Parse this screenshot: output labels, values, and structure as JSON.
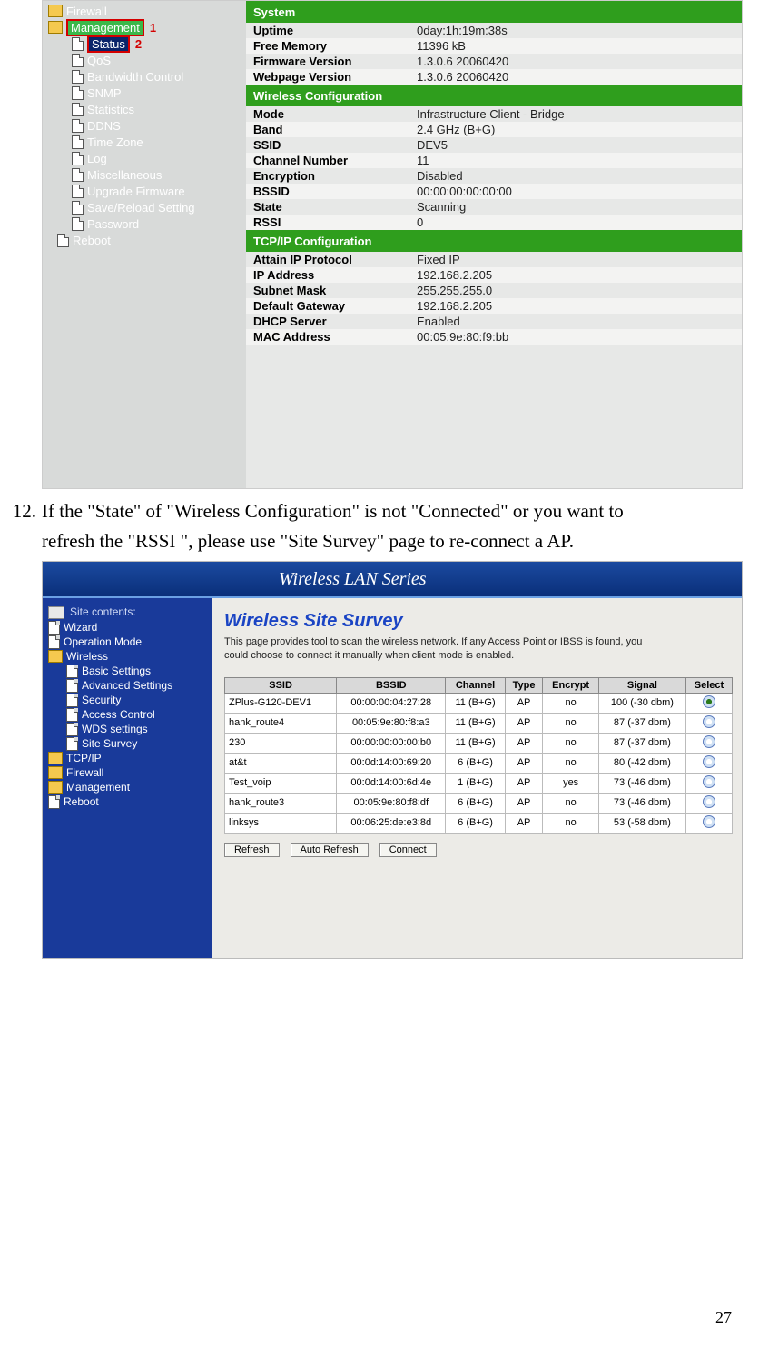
{
  "page_number": "27",
  "instruction": {
    "num": "12.",
    "text_l1": "If the \"State\" of \"Wireless Configuration\" is not \"Connected\" or you want to",
    "text_l2": "refresh the \"RSSI \", please use \"Site Survey\" page to re-connect a AP."
  },
  "shot1": {
    "tree": {
      "firewall": "Firewall",
      "management": "Management",
      "mgmt_badge": "1",
      "status": "Status",
      "status_badge": "2",
      "items": [
        "QoS",
        "Bandwidth Control",
        "SNMP",
        "Statistics",
        "DDNS",
        "Time Zone",
        "Log",
        "Miscellaneous",
        "Upgrade Firmware",
        "Save/Reload Setting",
        "Password"
      ],
      "reboot": "Reboot"
    },
    "sections": [
      {
        "header": "System",
        "rows": [
          {
            "k": "Uptime",
            "v": "0day:1h:19m:38s"
          },
          {
            "k": "Free Memory",
            "v": "11396 kB"
          },
          {
            "k": "Firmware Version",
            "v": "1.3.0.6 20060420"
          },
          {
            "k": "Webpage Version",
            "v": "1.3.0.6 20060420"
          }
        ]
      },
      {
        "header": "Wireless Configuration",
        "rows": [
          {
            "k": "Mode",
            "v": "Infrastructure Client - Bridge"
          },
          {
            "k": "Band",
            "v": "2.4 GHz (B+G)"
          },
          {
            "k": "SSID",
            "v": "DEV5"
          },
          {
            "k": "Channel Number",
            "v": "11"
          },
          {
            "k": "Encryption",
            "v": "Disabled"
          },
          {
            "k": "BSSID",
            "v": "00:00:00:00:00:00"
          },
          {
            "k": "State",
            "v": "Scanning"
          },
          {
            "k": "RSSI",
            "v": "0"
          }
        ]
      },
      {
        "header": "TCP/IP Configuration",
        "rows": [
          {
            "k": "Attain IP Protocol",
            "v": "Fixed IP"
          },
          {
            "k": "IP Address",
            "v": "192.168.2.205"
          },
          {
            "k": "Subnet Mask",
            "v": "255.255.255.0"
          },
          {
            "k": "Default Gateway",
            "v": "192.168.2.205"
          },
          {
            "k": "DHCP Server",
            "v": "Enabled"
          },
          {
            "k": "MAC Address",
            "v": "00:05:9e:80:f9:bb"
          }
        ]
      }
    ]
  },
  "shot2": {
    "banner": "Wireless LAN Series",
    "tree": {
      "label": "Site contents:",
      "top": [
        "Wizard",
        "Operation Mode"
      ],
      "wireless": "Wireless",
      "witems": [
        "Basic Settings",
        "Advanced Settings",
        "Security",
        "Access Control",
        "WDS settings",
        "Site Survey"
      ],
      "bottom_folders": [
        "TCP/IP",
        "Firewall",
        "Management"
      ],
      "reboot": "Reboot"
    },
    "panel": {
      "title": "Wireless Site Survey",
      "desc": "This page provides tool to scan the wireless network. If any Access Point or IBSS is found, you could choose to connect it manually when client mode is enabled.",
      "headers": [
        "SSID",
        "BSSID",
        "Channel",
        "Type",
        "Encrypt",
        "Signal",
        "Select"
      ],
      "rows": [
        {
          "ssid": "ZPlus-G120-DEV1",
          "bssid": "00:00:00:04:27:28",
          "ch": "11 (B+G)",
          "type": "AP",
          "enc": "no",
          "sig": "100 (-30 dbm)",
          "sel": true
        },
        {
          "ssid": "hank_route4",
          "bssid": "00:05:9e:80:f8:a3",
          "ch": "11 (B+G)",
          "type": "AP",
          "enc": "no",
          "sig": "87 (-37 dbm)",
          "sel": false
        },
        {
          "ssid": "230",
          "bssid": "00:00:00:00:00:b0",
          "ch": "11 (B+G)",
          "type": "AP",
          "enc": "no",
          "sig": "87 (-37 dbm)",
          "sel": false
        },
        {
          "ssid": "at&t",
          "bssid": "00:0d:14:00:69:20",
          "ch": "6 (B+G)",
          "type": "AP",
          "enc": "no",
          "sig": "80 (-42 dbm)",
          "sel": false
        },
        {
          "ssid": "Test_voip",
          "bssid": "00:0d:14:00:6d:4e",
          "ch": "1 (B+G)",
          "type": "AP",
          "enc": "yes",
          "sig": "73 (-46 dbm)",
          "sel": false
        },
        {
          "ssid": "hank_route3",
          "bssid": "00:05:9e:80:f8:df",
          "ch": "6 (B+G)",
          "type": "AP",
          "enc": "no",
          "sig": "73 (-46 dbm)",
          "sel": false
        },
        {
          "ssid": "linksys",
          "bssid": "00:06:25:de:e3:8d",
          "ch": "6 (B+G)",
          "type": "AP",
          "enc": "no",
          "sig": "53 (-58 dbm)",
          "sel": false
        }
      ],
      "buttons": {
        "refresh": "Refresh",
        "auto": "Auto Refresh",
        "connect": "Connect"
      }
    }
  }
}
